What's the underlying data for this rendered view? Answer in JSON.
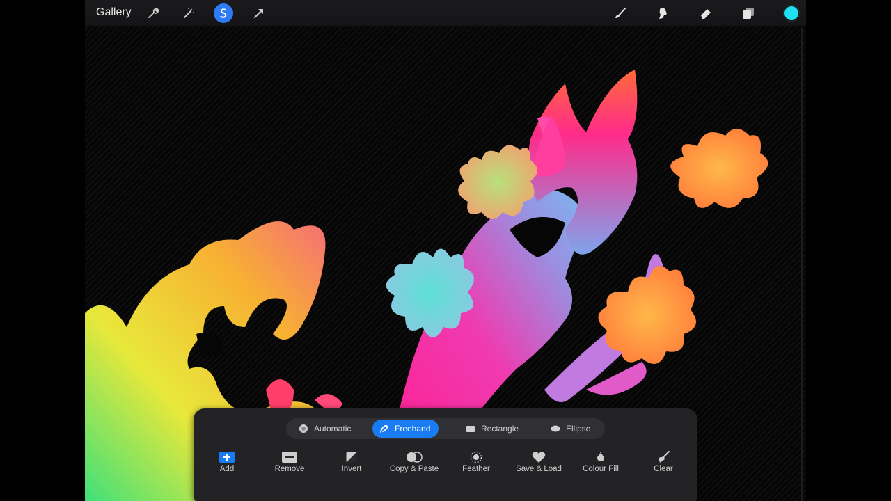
{
  "topbar": {
    "gallery_label": "Gallery",
    "left_icons": [
      "wrench-icon",
      "magic-wand-icon",
      "selection-icon",
      "transform-arrow-icon"
    ],
    "right_icons": [
      "brush-icon",
      "smudge-icon",
      "eraser-icon",
      "layers-icon"
    ],
    "active_tool": "selection",
    "current_color": "#1fe0f0"
  },
  "selection_modes": [
    {
      "label": "Automatic",
      "icon": "automatic-icon",
      "active": false
    },
    {
      "label": "Freehand",
      "icon": "freehand-icon",
      "active": true
    },
    {
      "label": "Rectangle",
      "icon": "rectangle-icon",
      "active": false
    },
    {
      "label": "Ellipse",
      "icon": "ellipse-icon",
      "active": false
    }
  ],
  "actions": [
    {
      "label": "Add",
      "icon": "add-icon"
    },
    {
      "label": "Remove",
      "icon": "remove-icon"
    },
    {
      "label": "Invert",
      "icon": "invert-icon"
    },
    {
      "label": "Copy & Paste",
      "icon": "copy-paste-icon"
    },
    {
      "label": "Feather",
      "icon": "feather-icon"
    },
    {
      "label": "Save & Load",
      "icon": "heart-icon"
    },
    {
      "label": "Colour Fill",
      "icon": "colour-fill-icon"
    },
    {
      "label": "Clear",
      "icon": "clear-icon"
    }
  ],
  "colors": {
    "accent": "#1a7cf2",
    "panel": "#232326"
  }
}
